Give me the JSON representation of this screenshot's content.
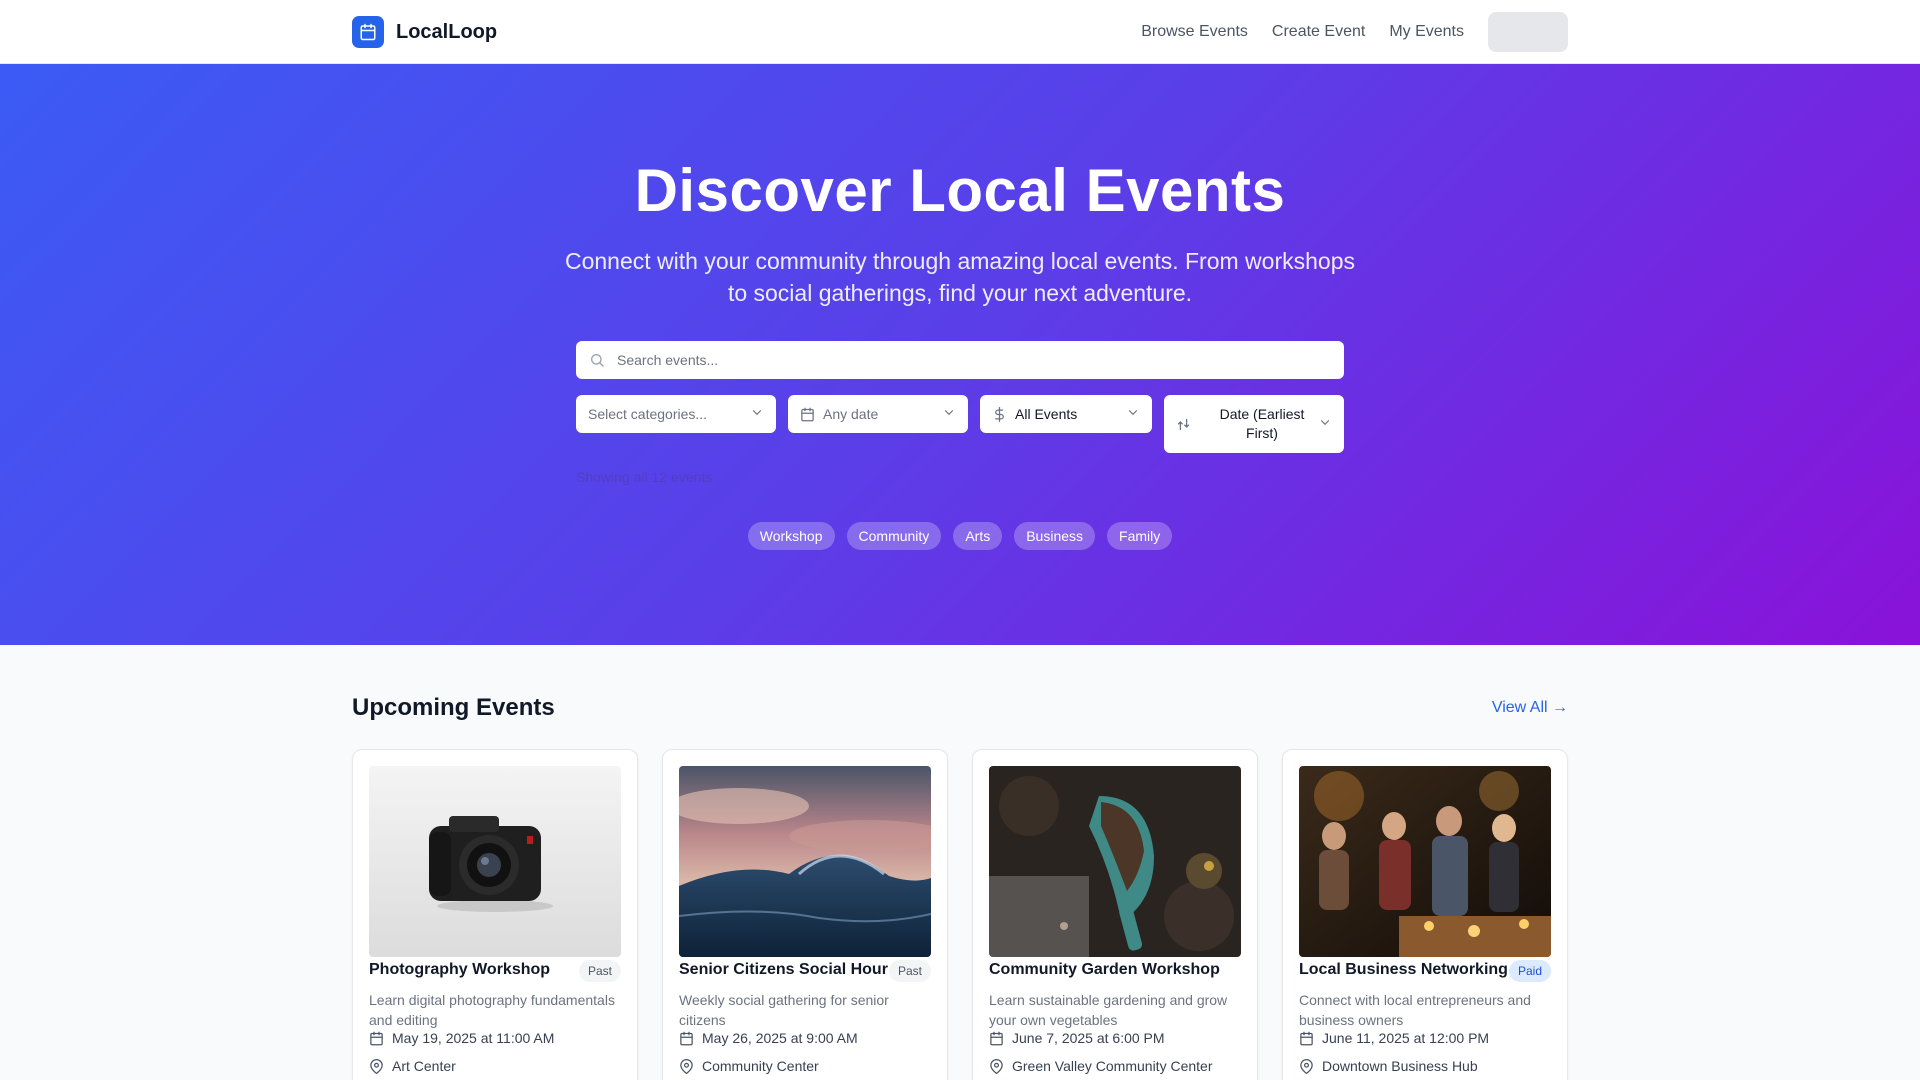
{
  "app": {
    "name": "LocalLoop"
  },
  "nav": {
    "items": [
      "Browse Events",
      "Create Event",
      "My Events"
    ]
  },
  "hero": {
    "title": "Discover Local Events",
    "subtitle": "Connect with your community through amazing local events. From workshops to social gatherings, find your next adventure.",
    "search_placeholder": "Search events...",
    "filters": {
      "categories_placeholder": "Select categories...",
      "date": "Any date",
      "price": "All Events",
      "sort": "Date (Earliest First)"
    },
    "showing_text": "Showing all 12 events",
    "chips": [
      "Workshop",
      "Community",
      "Arts",
      "Business",
      "Family"
    ]
  },
  "upcoming": {
    "title": "Upcoming Events",
    "view_all": "View All →",
    "events": [
      {
        "title": "Photography Workshop",
        "badge": "Past",
        "description": "Learn digital photography fundamentals and editing",
        "date": "May 19, 2025 at 11:00 AM",
        "location": "Art Center",
        "image": "camera-photo"
      },
      {
        "title": "Senior Citizens Social Hour",
        "badge": "Past",
        "description": "Weekly social gathering for senior citizens",
        "date": "May 26, 2025 at 9:00 AM",
        "location": "Community Center",
        "image": "ocean-wave-photo"
      },
      {
        "title": "Community Garden Workshop",
        "badge": "",
        "description": "Learn sustainable gardening and grow your own vegetables",
        "date": "June 7, 2025 at 6:00 PM",
        "location": "Green Valley Community Center",
        "image": "garden-trowel-photo"
      },
      {
        "title": "Local Business Networking",
        "badge": "Paid",
        "description": "Connect with local entrepreneurs and business owners",
        "date": "June 11, 2025 at 12:00 PM",
        "location": "Downtown Business Hub",
        "image": "networking-event-photo"
      }
    ]
  },
  "colors": {
    "accent": "#2563eb",
    "hero_gradient_start": "#3b5bf5",
    "hero_gradient_end": "#8a12d9"
  }
}
